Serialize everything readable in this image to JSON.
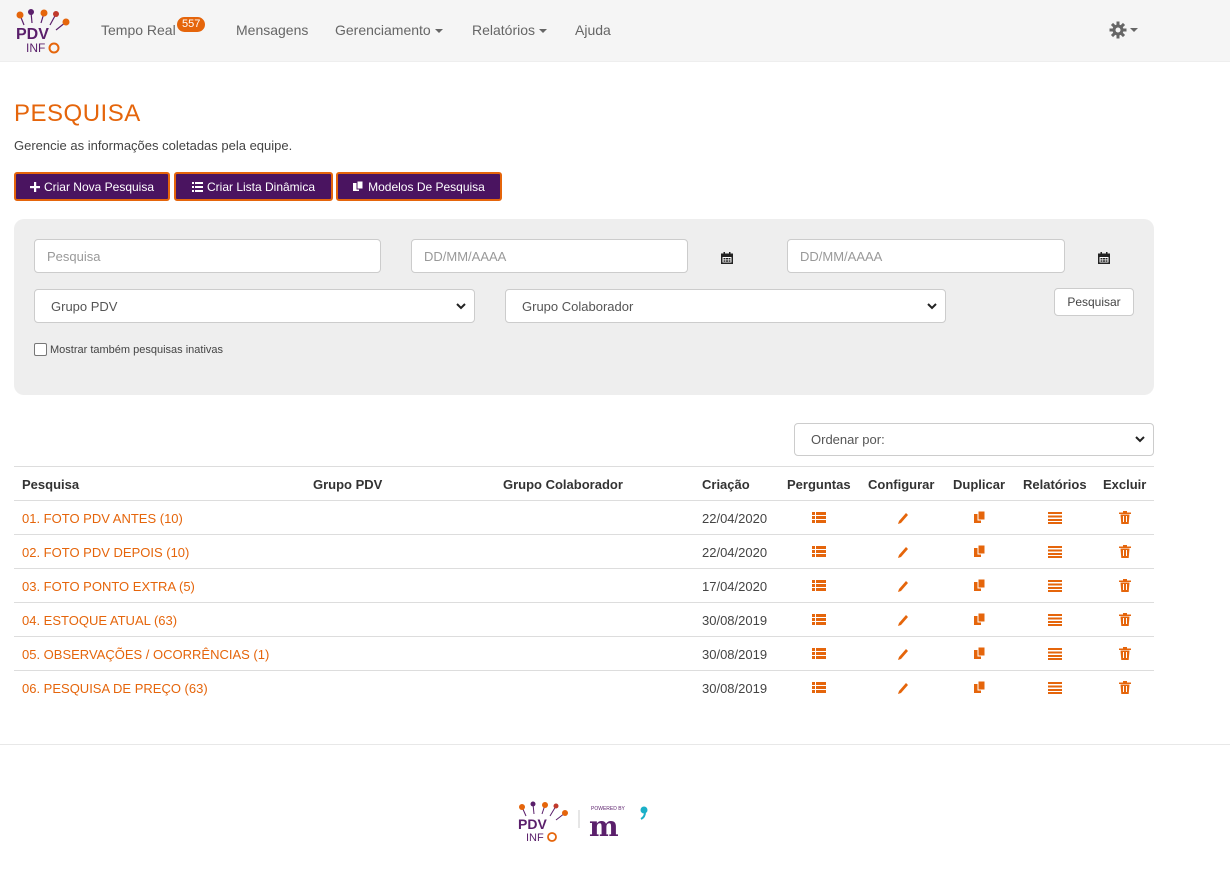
{
  "nav": {
    "logo_text": "PDV INFO",
    "items": [
      {
        "label": "Tempo Real",
        "badge": "557"
      },
      {
        "label": "Mensagens"
      },
      {
        "label": "Gerenciamento"
      },
      {
        "label": "Relatórios"
      },
      {
        "label": "Ajuda"
      }
    ],
    "settings_icon": "gear-icon"
  },
  "header": {
    "title": "PESQUISA",
    "subtitle": "Gerencie as informações coletadas pela equipe."
  },
  "actions": {
    "create_survey": "Criar Nova Pesquisa",
    "create_list": "Criar Lista Dinâmica",
    "templates": "Modelos De Pesquisa"
  },
  "filters": {
    "search_placeholder": "Pesquisa",
    "date_from_placeholder": "DD/MM/AAAA",
    "date_to_placeholder": "DD/MM/AAAA",
    "grupo_pdv": "Grupo PDV",
    "grupo_colaborador": "Grupo Colaborador",
    "search_button": "Pesquisar",
    "inactive_label": "Mostrar também pesquisas inativas"
  },
  "order_by": "Ordenar por:",
  "table": {
    "headers": [
      "Pesquisa",
      "Grupo PDV",
      "Grupo Colaborador",
      "Criação",
      "Perguntas",
      "Configurar",
      "Duplicar",
      "Relatórios",
      "Excluir"
    ],
    "rows": [
      {
        "name": "01. FOTO PDV ANTES (10)",
        "grupo_pdv": "",
        "grupo_colab": "",
        "date": "22/04/2020"
      },
      {
        "name": "02. FOTO PDV DEPOIS (10)",
        "grupo_pdv": "",
        "grupo_colab": "",
        "date": "22/04/2020"
      },
      {
        "name": "03. FOTO PONTO EXTRA (5)",
        "grupo_pdv": "",
        "grupo_colab": "",
        "date": "17/04/2020"
      },
      {
        "name": "04. ESTOQUE ATUAL (63)",
        "grupo_pdv": "",
        "grupo_colab": "",
        "date": "30/08/2019"
      },
      {
        "name": "05. OBSERVAÇÕES / OCORRÊNCIAS (1)",
        "grupo_pdv": "",
        "grupo_colab": "",
        "date": "30/08/2019"
      },
      {
        "name": "06. PESQUISA DE PREÇO (63)",
        "grupo_pdv": "",
        "grupo_colab": "",
        "date": "30/08/2019"
      }
    ]
  },
  "footer": {
    "logo_text": "PDV INFO",
    "powered_by": "POWERED BY"
  },
  "colors": {
    "accent": "#e5650b",
    "brand_purple": "#4a1460",
    "panel": "#eeeeee"
  }
}
